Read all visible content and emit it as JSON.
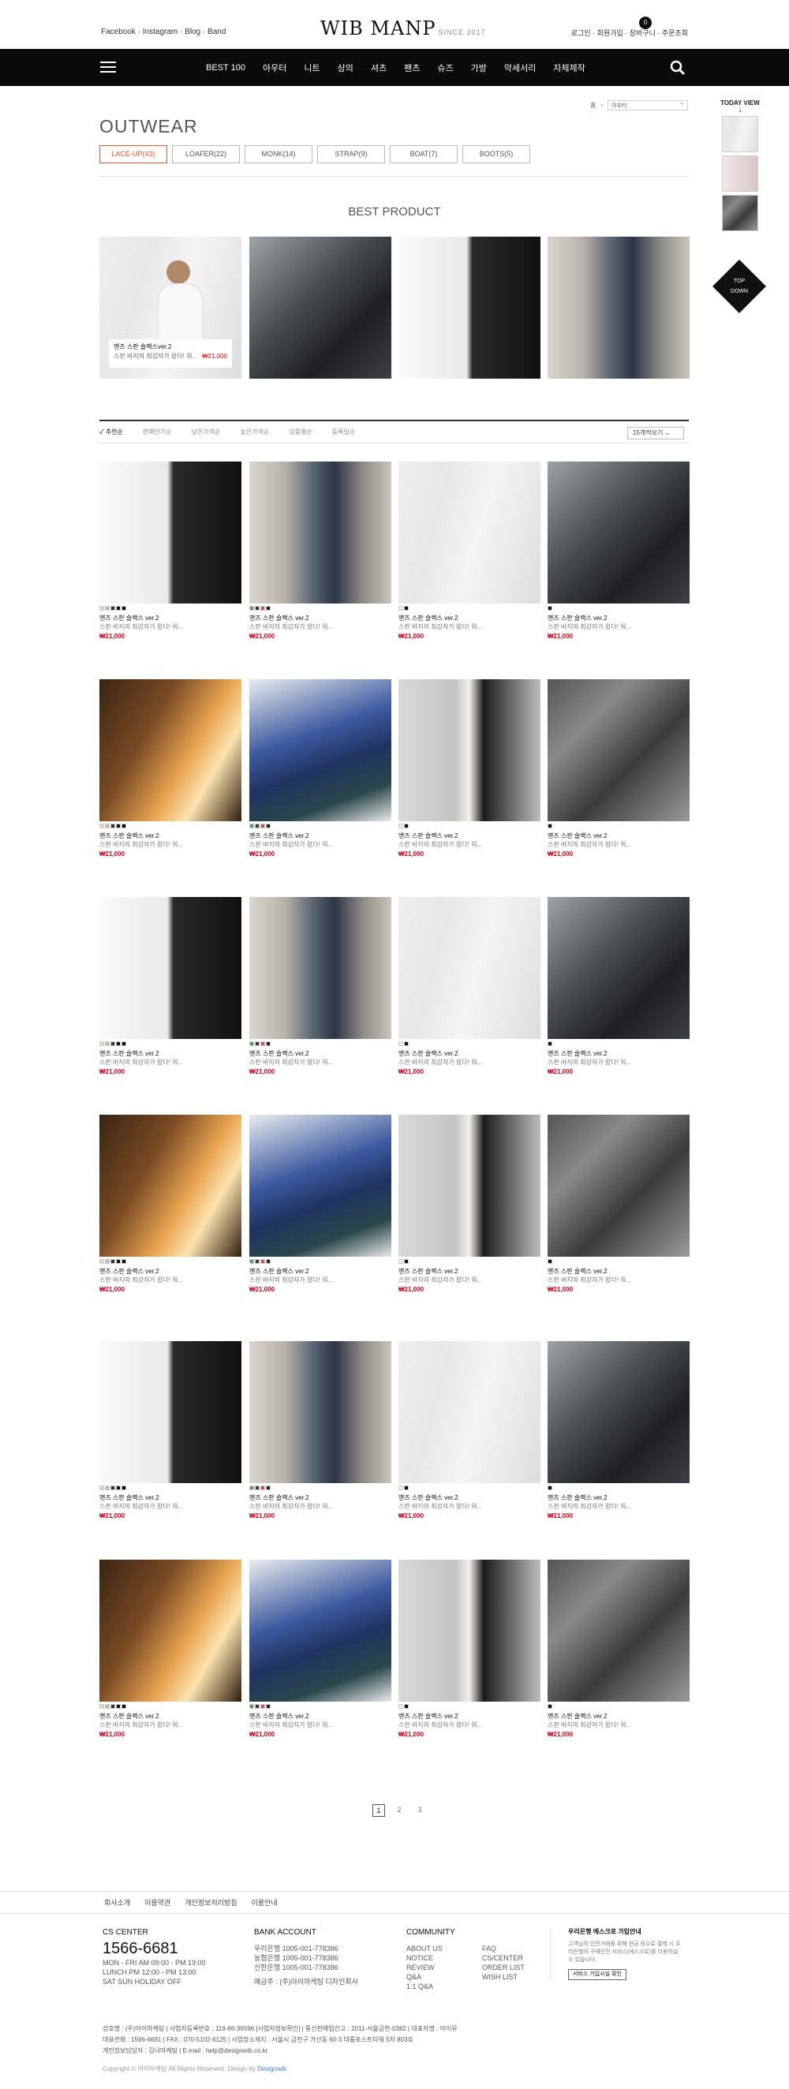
{
  "header": {
    "social_links": "Facebook · Instagram · Blog · Band",
    "logo": "WIB MANP",
    "logo_since": "SINCE 2017",
    "user_menu": "로그인 · 회원가입 · 장바구니 · 주문조회",
    "cart_count": "0"
  },
  "nav": {
    "items": [
      "BEST 100",
      "아우터",
      "니트",
      "상의",
      "셔츠",
      "팬츠",
      "슈즈",
      "가방",
      "악세서리",
      "자체제작"
    ]
  },
  "sidebar": {
    "today_view": "TODAY VIEW",
    "top_label": "TOP",
    "down_label": "DOWN"
  },
  "breadcrumb": {
    "home": "홈",
    "select": "아우터"
  },
  "category": {
    "title": "OUTWEAR",
    "tabs": [
      "LACE-UP(43)",
      "LOAFER(22)",
      "MONK(14)",
      "STRAP(9)",
      "BOAT(7)",
      "BOOTS(5)"
    ]
  },
  "best": {
    "title": "BEST PRODUCT",
    "caption_name": "맨즈 스판 슬랙스ver.2",
    "caption_desc": "스판 바지의 최강자가 왔다! 워...",
    "caption_price": "₩21,000"
  },
  "sort": {
    "items": [
      "추천순",
      "판매인기순",
      "낮은가격순",
      "높은가격순",
      "상품평순",
      "등록일순"
    ],
    "per_page": "15개씩보기"
  },
  "product": {
    "name": "맨즈 스판 슬랙스 ver.2",
    "desc": "스판 바지의 최강자가 왔다! 워...",
    "price": "₩21,000"
  },
  "pagination": [
    "1",
    "2",
    "3"
  ],
  "footer": {
    "links": [
      "회사소개",
      "이용약관",
      "개인정보처리방침",
      "이용안내"
    ],
    "cs_title": "CS CENTER",
    "cs_phone": "1566-6681",
    "cs_hours": [
      "MON - FRI AM 09:00 - PM 19:00",
      "LUNCH PM 12:00 - PM 13:00",
      "SAT SUN HOLIDAY OFF"
    ],
    "bank_title": "BANK ACCOUNT",
    "banks": [
      "우리은행  1005-001-778386",
      "농협은행  1005-001-778386",
      "신한은행  1005-001-778386"
    ],
    "bank_holder": "예금주 : (주)아이마케팅 디자인회사",
    "community_title": "COMMUNITY",
    "community_left": [
      "ABOUT US",
      "NOTICE",
      "REVIEW",
      "Q&A",
      "1:1 Q&A"
    ],
    "community_right": [
      "FAQ",
      "CS/CENTER",
      "ORDER LIST",
      "WISH LIST"
    ],
    "notice_title": "우리은행 에스크로 가입안내",
    "notice_text": "고객님의 안전거래를 위해 현금 등으로 결제 시 우리은행의 구매안전 서비스(에스크로)를 이용하실 수 있습니다.",
    "notice_button": "서비스 가입사실 확인",
    "company_line1": "상호명 : (주)아이마케팅  |  사업자등록번호 : 119-86-36596 [사업자정보확인]  |  통신판매업신고 : 2011-서울금천-0382  |  대표자명 : 아이뮤",
    "company_line2": "대표전화 : 1566-6681  |  FAX : 070-5102-6125  |  사업장소재지 : 서울시 금천구 가산동 60-3 대륭포스트타워 5차 803호",
    "company_line3": "개인정보담당자 : 김너마케팅  |  E-mail : help@designwib.co.kr",
    "copyright": "Copyright © 아이마케팅 All Rights Reserved. Design by",
    "copyright_link": "Designwib"
  },
  "colors": {
    "accent": "#e8582a",
    "price": "#d0021b",
    "nav_bg": "#0a0a0a"
  }
}
